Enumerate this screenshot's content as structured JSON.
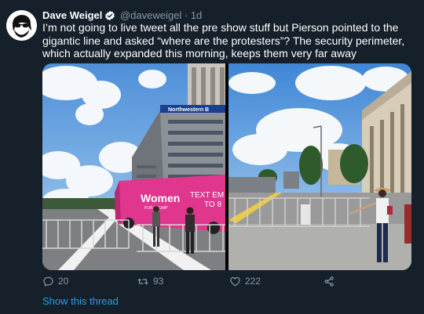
{
  "tweet": {
    "author_name": "Dave Weigel",
    "handle": "@daveweigel",
    "separator": "·",
    "time": "1d",
    "text": "I’m not going to live tweet all the pre show stuff but Pierson pointed to the gigantic line and asked “where are the protesters”? The security perimeter, which actually expanded this morning, keeps them very far away",
    "reply_count": "20",
    "retweet_count": "93",
    "like_count": "222",
    "show_thread": "Show this thread"
  },
  "media": {
    "photo1": {
      "building_sign": "Northwestern B",
      "bus_text_main": "Women",
      "bus_text_sub": "FOR TRUMP",
      "bus_text_right_1": "TEXT EM",
      "bus_text_right_2": "TO 8"
    }
  },
  "colors": {
    "background": "#15202b",
    "secondary_text": "#8899a6",
    "link": "#1da1f2",
    "verified": "#1da1f2"
  }
}
